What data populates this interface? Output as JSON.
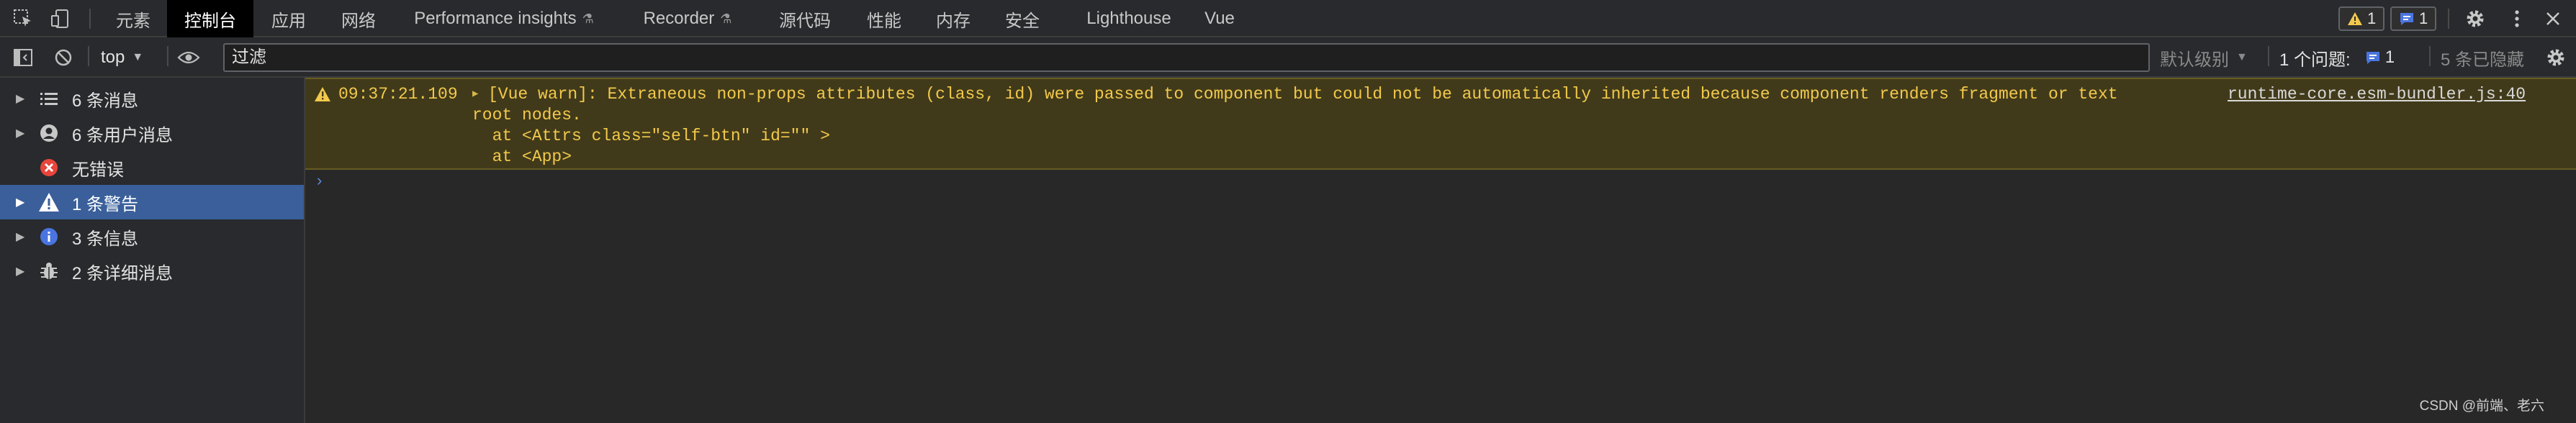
{
  "tabs": [
    {
      "label": "元素"
    },
    {
      "label": "控制台"
    },
    {
      "label": "应用"
    },
    {
      "label": "网络"
    },
    {
      "label": "Performance insights"
    },
    {
      "label": "Recorder"
    },
    {
      "label": "源代码"
    },
    {
      "label": "性能"
    },
    {
      "label": "内存"
    },
    {
      "label": "安全"
    },
    {
      "label": "Lighthouse"
    },
    {
      "label": "Vue"
    }
  ],
  "topbar": {
    "warning_badge_count": "1",
    "info_badge_count": "1"
  },
  "toolbar": {
    "context": "top",
    "filter_placeholder": "过滤",
    "levels": "默认级别",
    "issues_label": "1 个问题:",
    "issues_count": "1",
    "hidden": "5 条已隐藏"
  },
  "sidebar": {
    "items": [
      {
        "label": "6 条消息",
        "icon": "list-icon"
      },
      {
        "label": "6 条用户消息",
        "icon": "user-icon"
      },
      {
        "label": "无错误",
        "icon": "error-icon"
      },
      {
        "label": "1 条警告",
        "icon": "warning-icon"
      },
      {
        "label": "3 条信息",
        "icon": "info-icon"
      },
      {
        "label": "2 条详细消息",
        "icon": "bug-icon"
      }
    ]
  },
  "console": {
    "warning": {
      "timestamp": "09:37:21.109",
      "line1": "[Vue warn]: Extraneous non-props attributes (class, id) were passed to component but could not be automatically inherited because component renders fragment or text",
      "line2": "root nodes.",
      "line3": "  at <Attrs class=\"self-btn\" id=\"\" >",
      "line4": "  at <App>",
      "source": "runtime-core.esm-bundler.js:40"
    },
    "prompt_symbol": "›"
  },
  "watermark": "CSDN @前端、老六",
  "colors": {
    "warning": "#f2c94c",
    "selected": "#3a5f9a",
    "info": "#4a74e0",
    "error": "#e8453c"
  }
}
